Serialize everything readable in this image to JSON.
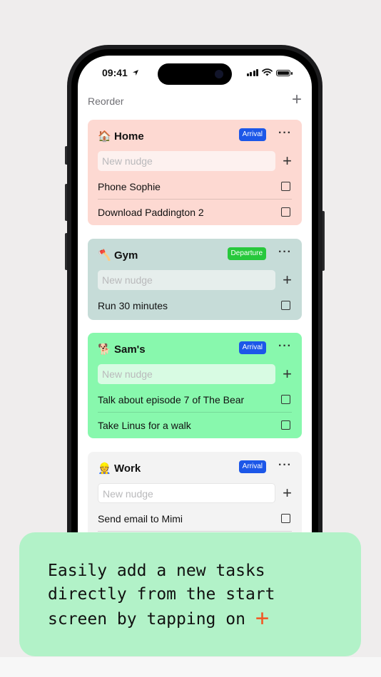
{
  "status_bar": {
    "time": "09:41"
  },
  "header": {
    "reorder_label": "Reorder",
    "add_icon": "plus-icon"
  },
  "colors": {
    "arrival_badge": "#1c57e8",
    "departure_badge": "#27c83c",
    "home_card": "#fdd9d2",
    "gym_card": "#c6dcd8",
    "sams_card": "#88f8ad",
    "work_card": "#f3f3f3",
    "accent": "#f05a28"
  },
  "cards": [
    {
      "emoji": "🏠",
      "title": "Home",
      "badge": "Arrival",
      "placeholder": "New nudge",
      "tasks": [
        "Phone Sophie",
        "Download Paddington 2"
      ]
    },
    {
      "emoji": "🪓",
      "title": "Gym",
      "badge": "Departure",
      "placeholder": "New nudge",
      "tasks": [
        "Run 30 minutes"
      ]
    },
    {
      "emoji": "🐕",
      "title": "Sam's",
      "badge": "Arrival",
      "placeholder": "New nudge",
      "tasks": [
        "Talk about episode 7 of The Bear",
        "Take Linus for a walk"
      ]
    },
    {
      "emoji": "👷",
      "title": "Work",
      "badge": "Arrival",
      "placeholder": "New nudge",
      "tasks": [
        "Send email to Mimi"
      ]
    }
  ],
  "callout": {
    "line1": "Easily add a new tasks",
    "line2": "directly from the start",
    "line3": "screen by tapping on",
    "plus_glyph": "+"
  }
}
